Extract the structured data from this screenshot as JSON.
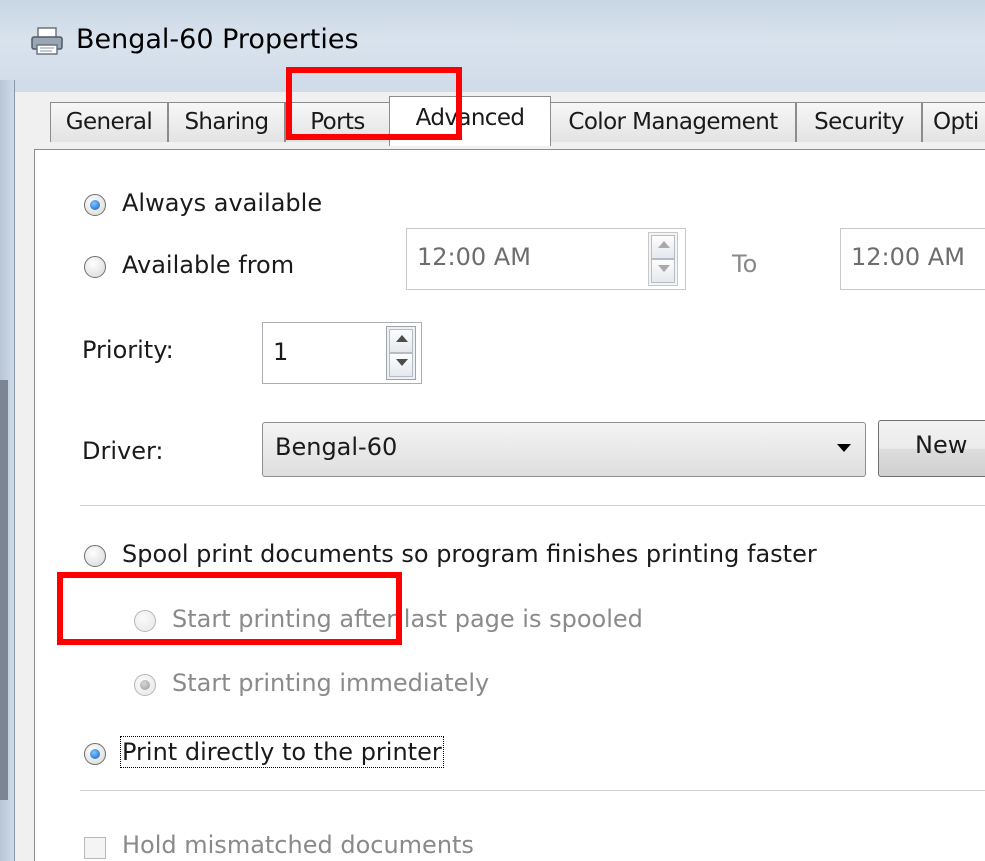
{
  "window": {
    "title": "Bengal-60 Properties",
    "icon": "printer-icon"
  },
  "tabs": [
    {
      "label": "General",
      "active": false
    },
    {
      "label": "Sharing",
      "active": false
    },
    {
      "label": "Ports",
      "active": false
    },
    {
      "label": "Advanced",
      "active": true
    },
    {
      "label": "Color Management",
      "active": false
    },
    {
      "label": "Security",
      "active": false
    },
    {
      "label": "Opti",
      "active": false
    }
  ],
  "availability": {
    "always_label": "Always available",
    "from_label": "Available from",
    "selected": "always",
    "from_time": "12:00 AM",
    "to_label": "To",
    "to_time": "12:00 AM"
  },
  "priority": {
    "label": "Priority:",
    "value": "1"
  },
  "driver": {
    "label": "Driver:",
    "value": "Bengal-60",
    "new_button_label": "New"
  },
  "spooling": {
    "spool_label": "Spool print documents so program finishes printing faster",
    "after_last_page_label": "Start printing after last page is spooled",
    "immediately_label": "Start printing immediately",
    "direct_label": "Print directly to the printer",
    "selected": "direct"
  },
  "hold_mismatched_label": "Hold mismatched documents",
  "highlight_color": "#ff0000"
}
